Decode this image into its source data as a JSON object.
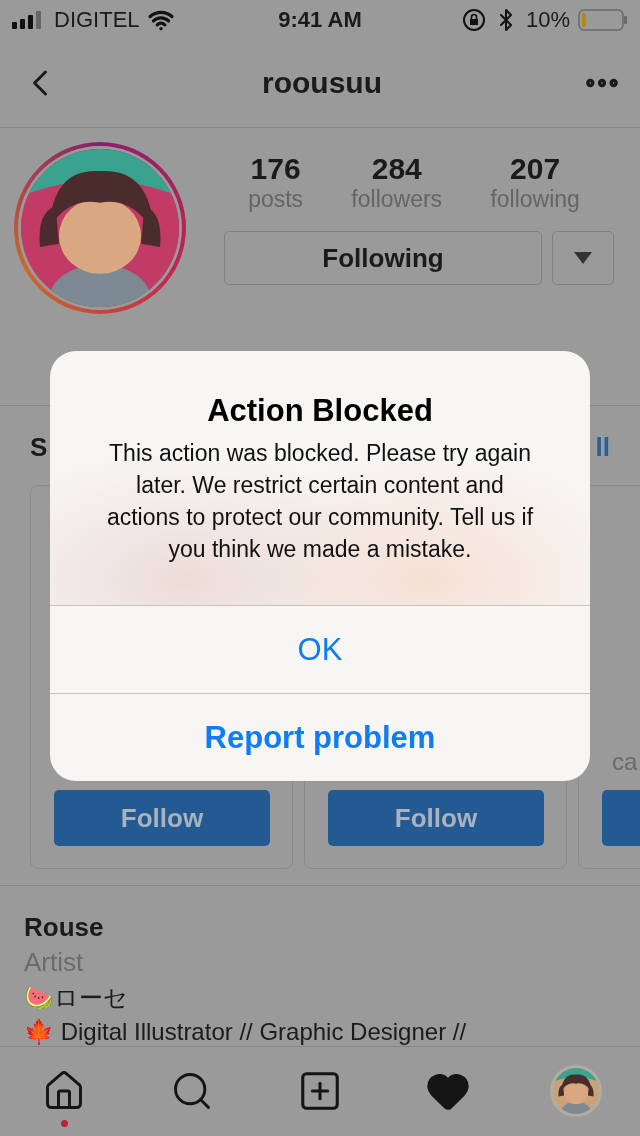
{
  "status_bar": {
    "carrier": "DIGITEL",
    "time": "9:41 AM",
    "battery": "10%"
  },
  "nav": {
    "title": "roousuu"
  },
  "stats": [
    {
      "value": "176",
      "label": "posts"
    },
    {
      "value": "284",
      "label": "followers"
    },
    {
      "value": "207",
      "label": "following"
    }
  ],
  "follow_button": {
    "label": "Following"
  },
  "suggestions": {
    "title": "S",
    "see_all": "ll",
    "cards": [
      {
        "button": "Follow"
      },
      {
        "button": "Follow"
      },
      {
        "caption": "ca"
      }
    ]
  },
  "bio": {
    "name": "Rouse",
    "category": "Artist",
    "lines": [
      "🍉ローセ",
      "🍁 Digital Illustrator // Graphic Designer //"
    ]
  },
  "tab_bar": [
    {
      "kind": "home",
      "selected": false,
      "notification": true
    },
    {
      "kind": "search",
      "selected": false,
      "notification": false
    },
    {
      "kind": "add",
      "selected": false,
      "notification": false
    },
    {
      "kind": "activity",
      "selected": true,
      "notification": false
    },
    {
      "kind": "profile",
      "selected": false,
      "notification": false
    }
  ],
  "dialog": {
    "title": "Action Blocked",
    "message": "This action was blocked. Please try again later. We restrict certain content and actions to protect our community. Tell us if you think we made a mistake.",
    "buttons": [
      {
        "label": "OK",
        "emphasized": false
      },
      {
        "label": "Report problem",
        "emphasized": true
      }
    ]
  }
}
